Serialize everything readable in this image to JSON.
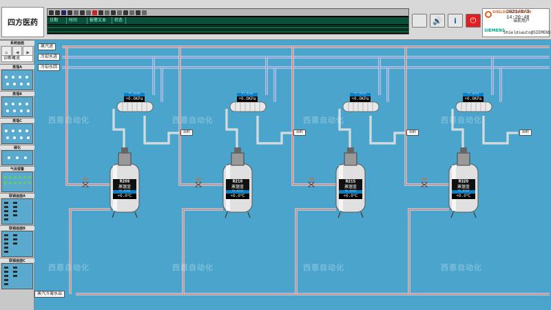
{
  "app": {
    "title": "四方医药"
  },
  "alarm_panel": {
    "columns": [
      "日期",
      "时间",
      "报警文本",
      "状态"
    ]
  },
  "header_info": {
    "datetime": "2021/8/3  14:20:48",
    "user": "当前用户",
    "logo_text": "SHIELDS AUTOMATION",
    "brand": "SIEMENS",
    "footer": "Shieldsauto@SIEMENS"
  },
  "sidebar": {
    "overview_title": "系统画面",
    "diag_label": "诊断概览",
    "sections": [
      {
        "label": "蒸馏A"
      },
      {
        "label": "蒸馏B"
      },
      {
        "label": "蒸馏C"
      },
      {
        "label": "碳化"
      },
      {
        "label": "气体报警"
      },
      {
        "label": "联锁画面A"
      },
      {
        "label": "联锁画面B"
      },
      {
        "label": "联锁画面C"
      }
    ]
  },
  "pipes": {
    "steam_in": "蒸汽进",
    "cooling_water_in": "冷却水进",
    "cooling_water_out": "冷却水回",
    "steam_condensate_out": "蒸汽冷凝水出",
    "outlet": "出料"
  },
  "watermark": {
    "text": "西恩自动化"
  },
  "reactors": [
    {
      "name": "R209",
      "status": "蒸馏釜",
      "sub": "TE_R209",
      "value": "+0.0℃",
      "cond_tag": "PT_R209",
      "cond_value": "+0.0KPa"
    },
    {
      "name": "R210",
      "status": "蒸馏釜",
      "sub": "TE_R210",
      "value": "+0.0℃",
      "cond_tag": "PT_R210",
      "cond_value": "+0.0KPa"
    },
    {
      "name": "R215",
      "status": "蒸馏釜",
      "sub": "TE_R215",
      "value": "+0.0℃",
      "cond_tag": "PT_R215",
      "cond_value": "+0.0KPa"
    },
    {
      "name": "R320",
      "status": "蒸馏釜",
      "sub": "TE_R320",
      "value": "+0.0℃",
      "cond_tag": "PT_R320",
      "cond_value": "+0.0KPa"
    }
  ]
}
